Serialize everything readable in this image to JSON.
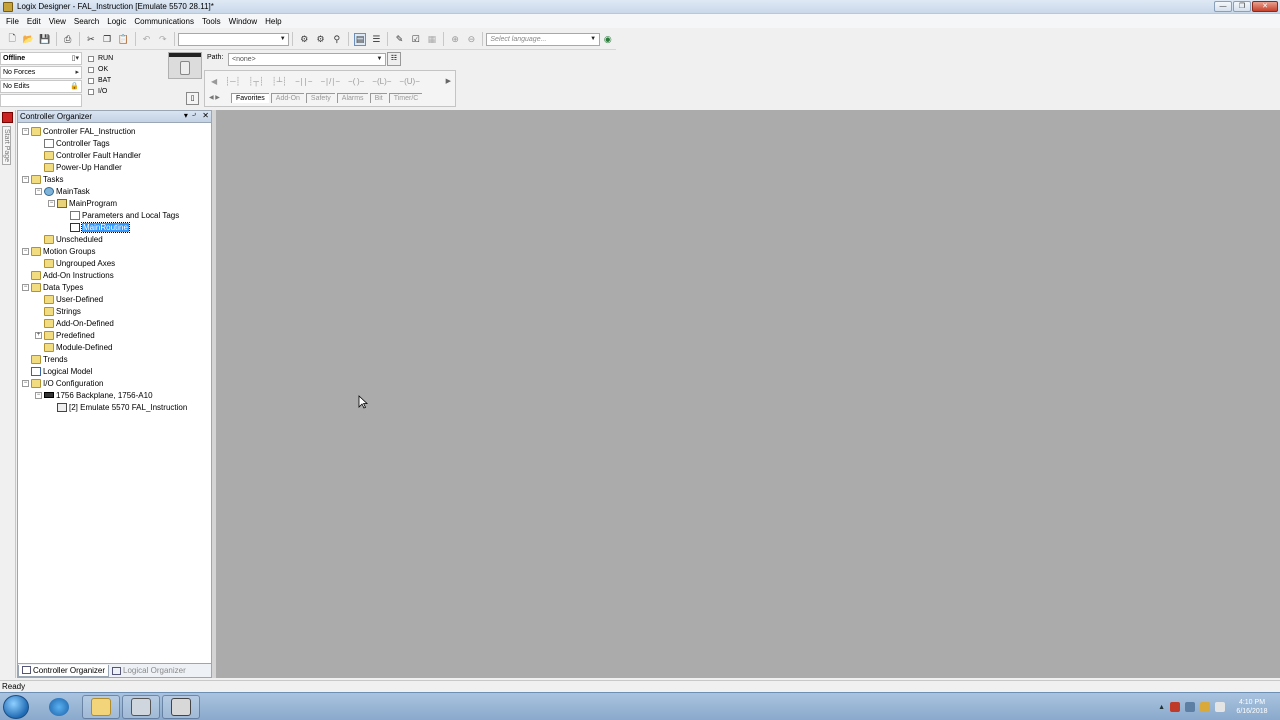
{
  "window": {
    "title": "Logix Designer - FAL_Instruction [Emulate 5570 28.11]*"
  },
  "menu": [
    "File",
    "Edit",
    "View",
    "Search",
    "Logic",
    "Communications",
    "Tools",
    "Window",
    "Help"
  ],
  "toolbar": {
    "language_placeholder": "Select language...",
    "combo_value": ""
  },
  "status": {
    "mode": "Offline",
    "forces": "No Forces",
    "edits": "No Edits",
    "leds": [
      "RUN",
      "OK",
      "BAT",
      "I/O"
    ]
  },
  "path": {
    "label": "Path:",
    "value": "<none>"
  },
  "instruction_tabs": [
    "Favorites",
    "Add-On",
    "Safety",
    "Alarms",
    "Bit",
    "Timer/C"
  ],
  "organizer": {
    "title": "Controller Organizer",
    "tabs": [
      "Controller Organizer",
      "Logical Organizer"
    ],
    "tree": [
      {
        "depth": 0,
        "label": "Controller FAL_Instruction",
        "icon": "folder",
        "exp": "-"
      },
      {
        "depth": 1,
        "label": "Controller Tags",
        "icon": "tags",
        "exp": ""
      },
      {
        "depth": 1,
        "label": "Controller Fault Handler",
        "icon": "folder",
        "exp": ""
      },
      {
        "depth": 1,
        "label": "Power-Up Handler",
        "icon": "folder",
        "exp": ""
      },
      {
        "depth": 0,
        "label": "Tasks",
        "icon": "folder",
        "exp": "-"
      },
      {
        "depth": 1,
        "label": "MainTask",
        "icon": "task",
        "exp": "-"
      },
      {
        "depth": 2,
        "label": "MainProgram",
        "icon": "prog",
        "exp": "-"
      },
      {
        "depth": 3,
        "label": "Parameters and Local Tags",
        "icon": "tags",
        "exp": ""
      },
      {
        "depth": 3,
        "label": "MainRoutine",
        "icon": "routine",
        "exp": "",
        "selected": true
      },
      {
        "depth": 1,
        "label": "Unscheduled",
        "icon": "folder",
        "exp": ""
      },
      {
        "depth": 0,
        "label": "Motion Groups",
        "icon": "folder",
        "exp": "-"
      },
      {
        "depth": 1,
        "label": "Ungrouped Axes",
        "icon": "folder",
        "exp": ""
      },
      {
        "depth": 0,
        "label": "Add-On Instructions",
        "icon": "folder",
        "exp": ""
      },
      {
        "depth": 0,
        "label": "Data Types",
        "icon": "folder",
        "exp": "-"
      },
      {
        "depth": 1,
        "label": "User-Defined",
        "icon": "folder",
        "exp": ""
      },
      {
        "depth": 1,
        "label": "Strings",
        "icon": "folder",
        "exp": ""
      },
      {
        "depth": 1,
        "label": "Add-On-Defined",
        "icon": "folder",
        "exp": ""
      },
      {
        "depth": 1,
        "label": "Predefined",
        "icon": "folder",
        "exp": "+"
      },
      {
        "depth": 1,
        "label": "Module-Defined",
        "icon": "folder",
        "exp": ""
      },
      {
        "depth": 0,
        "label": "Trends",
        "icon": "folder",
        "exp": ""
      },
      {
        "depth": 0,
        "label": "Logical Model",
        "icon": "model",
        "exp": ""
      },
      {
        "depth": 0,
        "label": "I/O Configuration",
        "icon": "folder",
        "exp": "-"
      },
      {
        "depth": 1,
        "label": "1756 Backplane, 1756-A10",
        "icon": "backplane",
        "exp": "-"
      },
      {
        "depth": 2,
        "label": "[2] Emulate 5570 FAL_Instruction",
        "icon": "module",
        "exp": ""
      }
    ]
  },
  "start_page": {
    "label": "Start Page"
  },
  "statusbar": {
    "text": "Ready"
  },
  "taskbar": {
    "clock_time": "4:10 PM",
    "clock_date": "6/16/2018"
  }
}
